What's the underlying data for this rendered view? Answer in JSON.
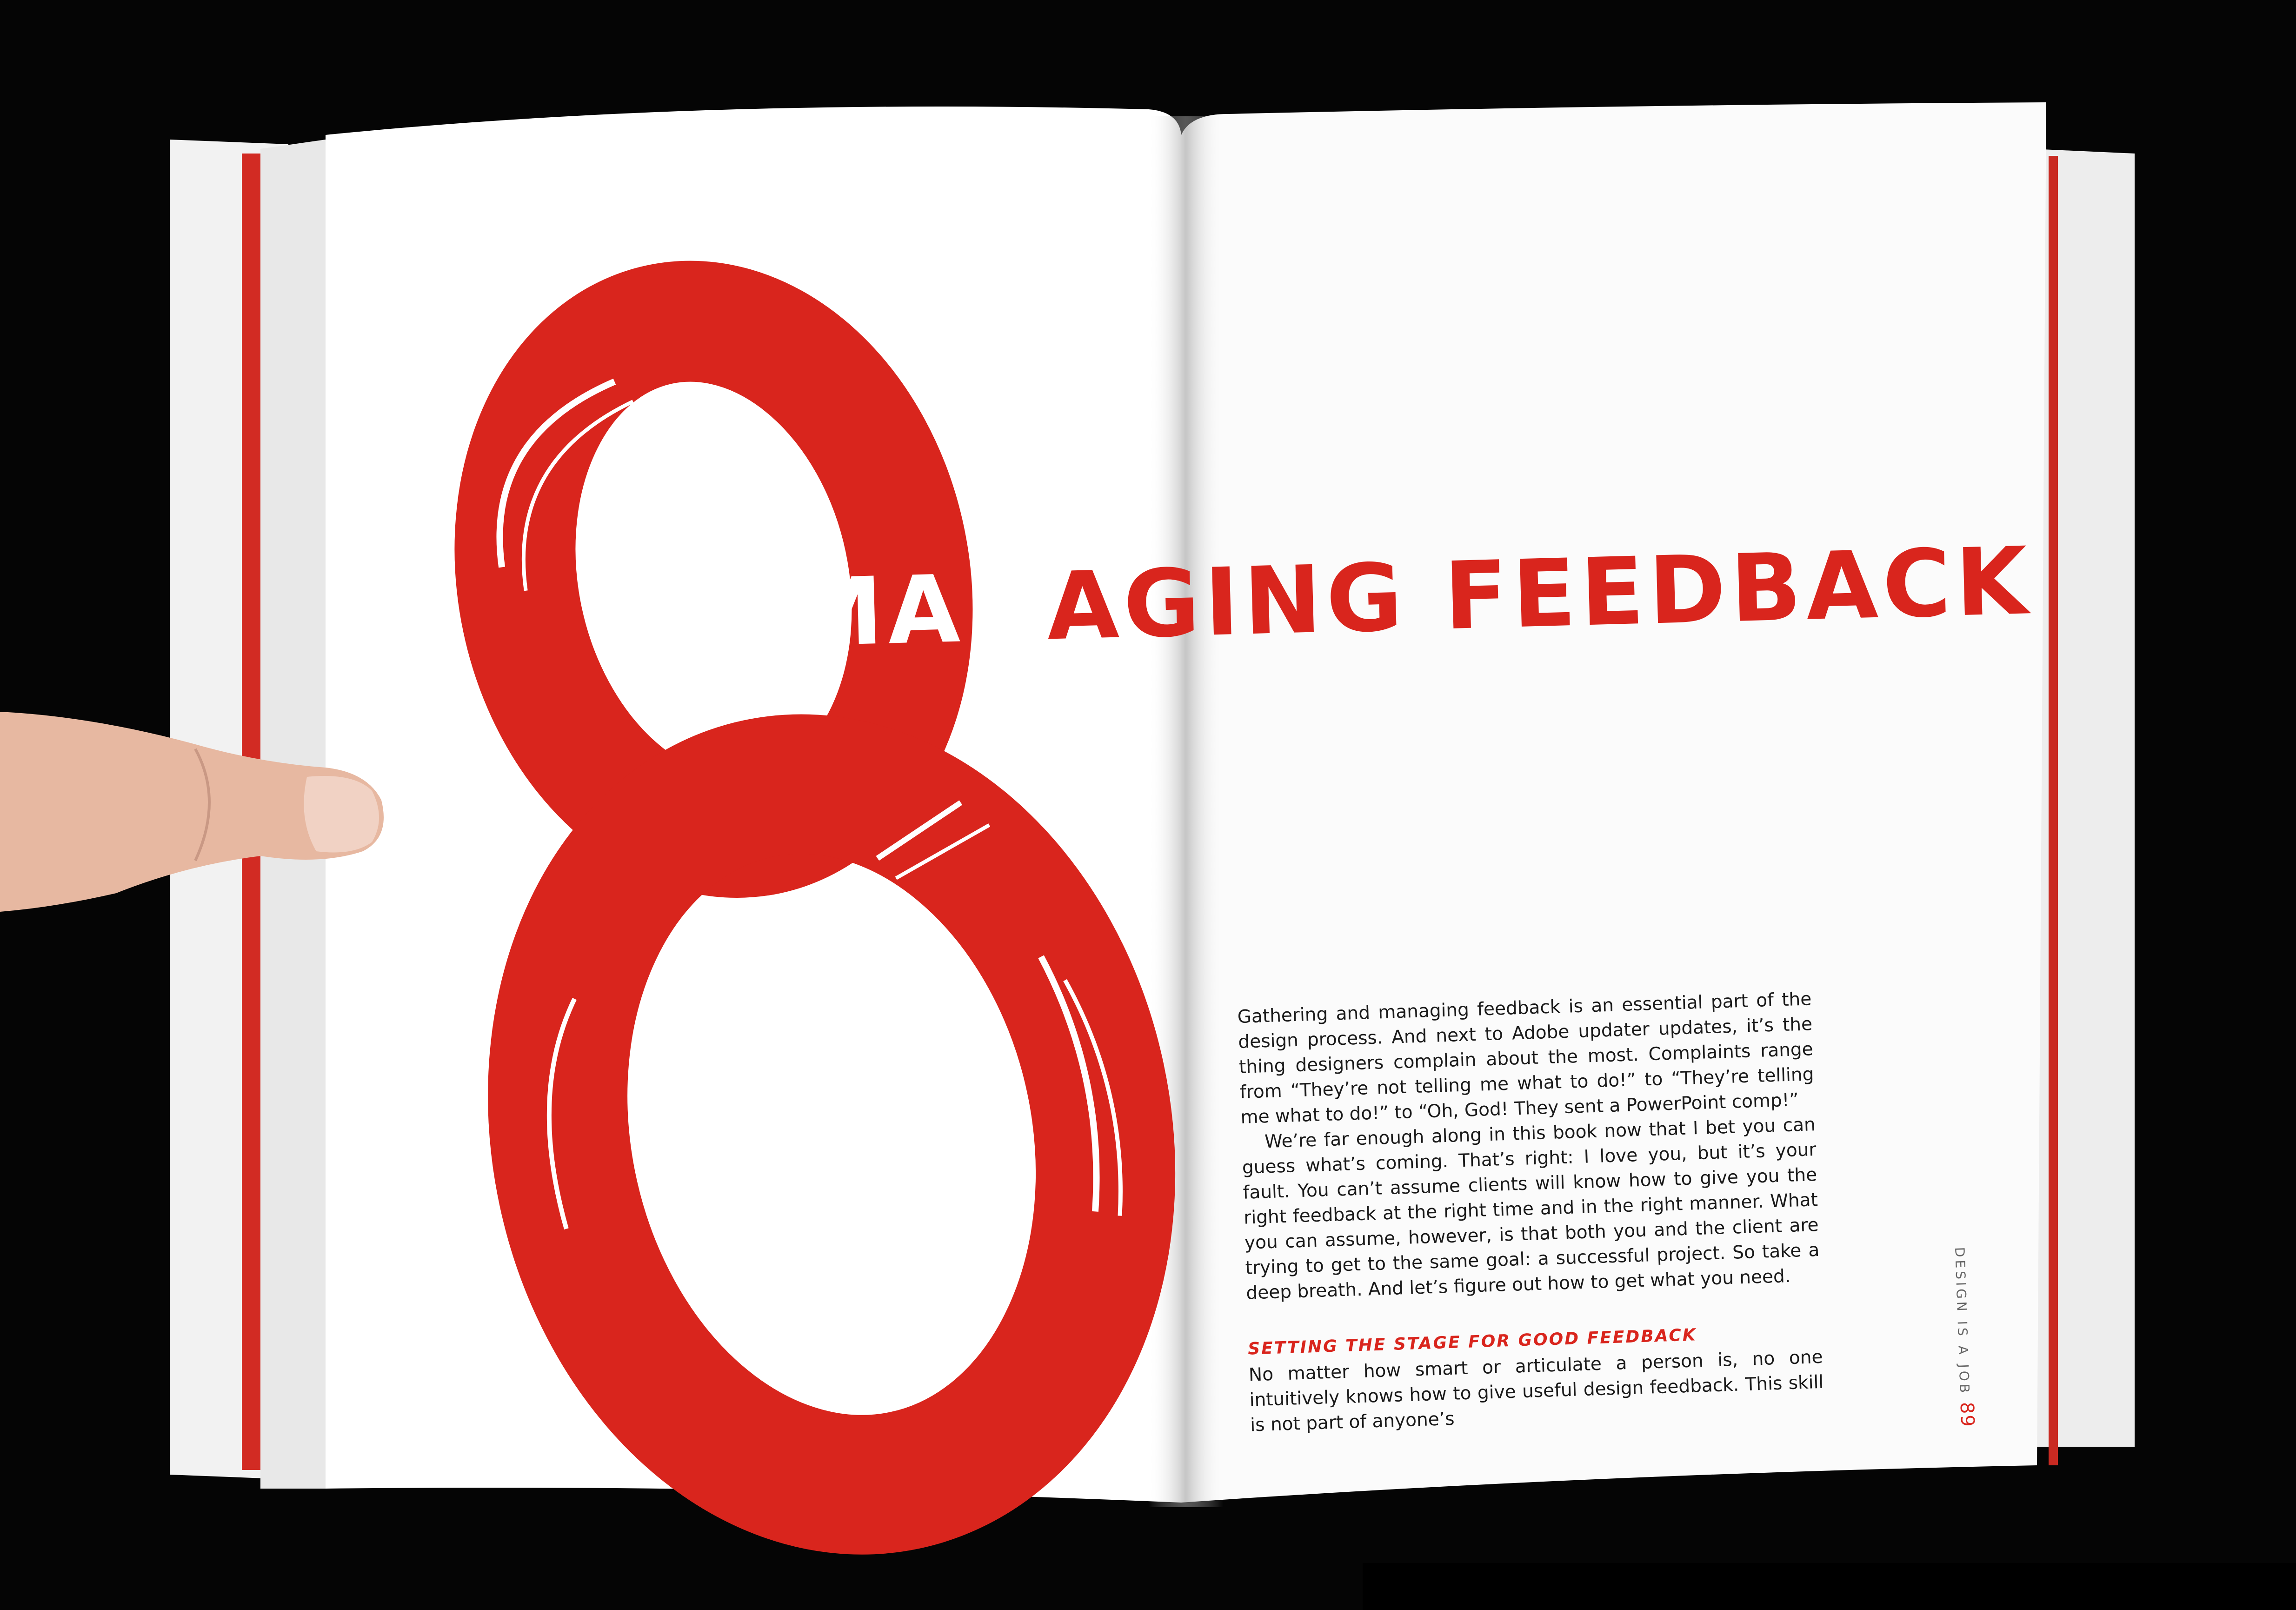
{
  "chapter": {
    "number": "8",
    "title_part_light": "MAN",
    "title_part_red": "AGING FEEDBACK"
  },
  "body": {
    "paragraph_1": "Gathering and managing feedback is an essential part of the design process. And next to Adobe updater updates, it’s the thing designers complain about the most. Complaints range from “They’re not telling me what to do!” to “They’re telling me what to do!” to “Oh, God! They sent a PowerPoint comp!”",
    "paragraph_2": "We’re far enough along in this book now that I bet you can guess what’s coming. That’s right: I love you, but it’s your fault. You can’t assume clients will know how to give you the right feedback at the right time and in the right manner. What you can assume, however, is that both you and the client are trying to get to the same goal: a successful project. So take a deep breath. And let’s figure out how to get what you need.",
    "section_heading": "SETTING THE STAGE FOR GOOD FEEDBACK",
    "section_text": "No matter how smart or articulate a person is, no one intuitively knows how to give useful design feedback. This skill is not part of anyone’s"
  },
  "running_foot": {
    "book_title": "DESIGN IS A JOB",
    "page_number": "89"
  },
  "colors": {
    "accent_red": "#d9251d",
    "page_white": "#ffffff",
    "background": "#050505",
    "skin": "#e7b8a1"
  }
}
